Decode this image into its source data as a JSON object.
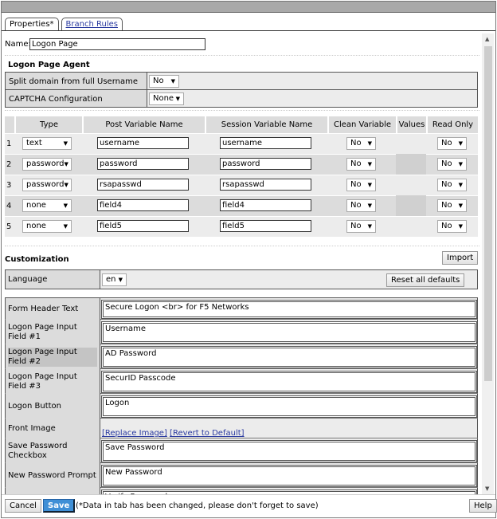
{
  "tabs": [
    {
      "label": "Properties*"
    },
    {
      "label": "Branch Rules"
    }
  ],
  "name": {
    "label": "Name:",
    "value": "Logon Page"
  },
  "agent": {
    "title": "Logon Page Agent",
    "split_label": "Split domain from full Username",
    "split_value": "No",
    "captcha_label": "CAPTCHA Configuration",
    "captcha_value": "None"
  },
  "fields": {
    "headers": [
      "Type",
      "Post Variable Name",
      "Session Variable Name",
      "Clean Variable",
      "Values",
      "Read Only"
    ],
    "rows": [
      {
        "n": "1",
        "type": "text",
        "post": "username",
        "session": "username",
        "clean": "No",
        "ro": "No"
      },
      {
        "n": "2",
        "type": "password",
        "post": "password",
        "session": "password",
        "clean": "No",
        "ro": "No"
      },
      {
        "n": "3",
        "type": "password",
        "post": "rsapasswd",
        "session": "rsapasswd",
        "clean": "No",
        "ro": "No"
      },
      {
        "n": "4",
        "type": "none",
        "post": "field4",
        "session": "field4",
        "clean": "No",
        "ro": "No"
      },
      {
        "n": "5",
        "type": "none",
        "post": "field5",
        "session": "field5",
        "clean": "No",
        "ro": "No"
      }
    ]
  },
  "custom": {
    "title": "Customization",
    "import": "Import",
    "language_label": "Language",
    "language_value": "en",
    "reset": "Reset all defaults",
    "rows": [
      {
        "label": "Form Header Text",
        "value": "Secure Logon <br> for F5 Networks"
      },
      {
        "label": "Logon Page Input Field #1",
        "value": "Username"
      },
      {
        "label": "Logon Page Input Field #2",
        "value": "AD Password"
      },
      {
        "label": "Logon Page Input Field #3",
        "value": "SecurID Passcode"
      },
      {
        "label": "Logon Button",
        "value": "Logon"
      },
      {
        "label": "Front Image",
        "replace": "[Replace Image]",
        "revert": "[Revert to Default]"
      },
      {
        "label": "Save Password Checkbox",
        "value": "Save Password"
      },
      {
        "label": "New Password Prompt",
        "value": "New Password"
      },
      {
        "label": "",
        "value": "Verify Password"
      }
    ]
  },
  "footer": {
    "cancel": "Cancel",
    "save": "Save",
    "note": "(*Data in tab has been changed, please don't forget to save)",
    "help": "Help"
  }
}
